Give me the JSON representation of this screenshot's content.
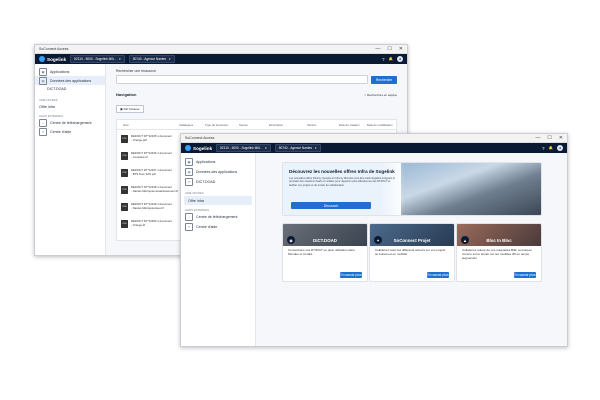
{
  "app": {
    "window_title": "SoConnect Access",
    "logo_text": "Sogelink",
    "account_select": "52110 - 5000 - Sogelink Mill...",
    "agency_select": "50740 - Agence Nantes",
    "minimize": "—",
    "maximize": "☐",
    "close": "✕",
    "help_icon": "?",
    "bell_icon": "🔔",
    "user_initial": "👤"
  },
  "back_window": {
    "sidebar": {
      "items": [
        {
          "label": "Applications"
        },
        {
          "label": "Données des applications"
        },
        {
          "label": "DICT.DOAD"
        }
      ],
      "group_offers": "AIDE OFFRES",
      "offer_item": "Offre infra",
      "group_external": "LIENS EXTERNES",
      "external_items": [
        {
          "label": "Centre de téléchargement"
        },
        {
          "label": "Centre d'aide"
        }
      ]
    },
    "search_title": "Rechercher une ressource",
    "search_button": "Recherche",
    "section_title": "Navigation",
    "advanced_link": "Recherches en équipe",
    "filter_chip": "Dirt Cleaner",
    "table_headers": [
      "Nom",
      "Catalogues",
      "Type de document",
      "Source",
      "Description",
      "Version",
      "Date de création",
      "Date de modification"
    ],
    "rows": [
      {
        "badge": "PDF",
        "name": "REFDICT DT*12345 1 document",
        "sub": "- Orange.pdf"
      },
      {
        "badge": "PDF",
        "name": "REFDICT DT*12346 1 document",
        "sub": "- Complete.tif"
      },
      {
        "badge": "PDF",
        "name": "REFDICT DT*12347 1 document",
        "sub": "- BTS Free SAS.pdf"
      },
      {
        "badge": "PDF",
        "name": "REFDICT DT*12348 1 document",
        "sub": "- Nantes Métropole assainissement.tif"
      },
      {
        "badge": "PDF",
        "name": "REFDICT DT*12349 1 document",
        "sub": "- Nantes Métropole Eau.tif"
      },
      {
        "badge": "PDF",
        "name": "REFDICT DT*12350 1 document",
        "sub": "- Orange.tif"
      }
    ]
  },
  "front_window": {
    "sidebar": {
      "items": [
        {
          "label": "Applications"
        },
        {
          "label": "Données des applications"
        },
        {
          "label": "DICT.DOAD"
        }
      ],
      "group_offers": "AIDE OFFRES",
      "offer_item": "Offre infra",
      "group_external": "LIENS EXTERNES",
      "external_items": [
        {
          "label": "Centre de téléchargement"
        },
        {
          "label": "Centre d'aide"
        }
      ]
    },
    "hero": {
      "title": "Découvrez les nouvelles offres Infra de Sogelink",
      "text": "Les nouvelles offres Infra by Geoptis et Infra by Mondeo sont des outils Sogelink intégrant le prochain des solutions SaaS et mobiles pour rapporter plus efficacement les DT/DICT et faciliter vos projets et de terrain de collaboration.",
      "button": "Découvrir"
    },
    "cards": [
      {
        "tag": "DICT.DOAD",
        "icon": "◉",
        "text": "Conventions vos DT/DICT en plein utilisation dans Mondeo et Coralis",
        "button": "En savoir plus"
      },
      {
        "tag": "SoConnect Projet",
        "icon": "✦",
        "text": "Collaborez avec les différents acteurs sur vos projets au bureau et en mobilité",
        "button": "En savoir plus"
      },
      {
        "tag": "Bloc In Bloc",
        "icon": "▲",
        "text": "Collaborez autour de vos maquettes BIM, au bureau comme sur le terrain sur les modèles 3D en temps augmentés",
        "button": "En savoir plus"
      }
    ]
  },
  "colors": {
    "topbar": "#0b1a33",
    "accent": "#1f6fd1"
  }
}
